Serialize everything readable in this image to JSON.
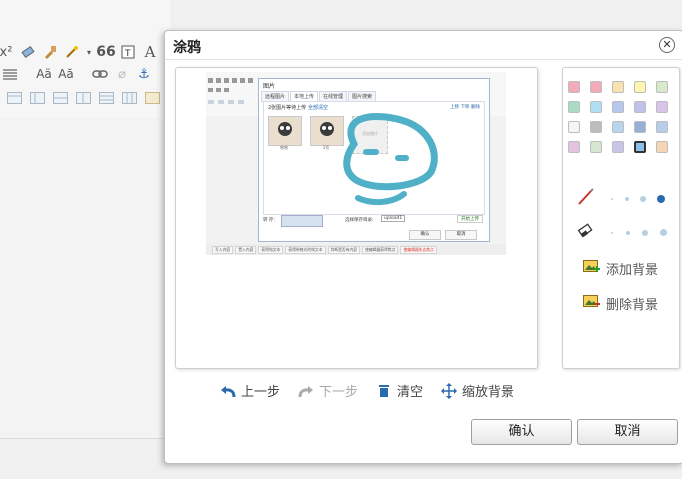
{
  "background": {
    "toolbar_rows": [
      {
        "icons": [
          "superscript-icon",
          "eraser-icon",
          "format-brush-icon",
          "magic-wand-icon",
          "chevron-down-icon",
          "quote-icon",
          "text-box-icon",
          "font-icon"
        ]
      },
      {
        "icons": [
          "align-justify-icon",
          "font-size-up-icon",
          "font-size-down-icon",
          "link-icon",
          "unlink-icon",
          "anchor-icon"
        ]
      },
      {
        "icons": [
          "table-icon",
          "table-row-icon",
          "table-col-icon",
          "table-merge-icon",
          "table-split-icon",
          "table-delete-icon",
          "image-icon"
        ]
      }
    ]
  },
  "dialog": {
    "title": "涂鸦",
    "close_glyph": "✕"
  },
  "canvas_screenshot": {
    "dialog_title": "图片",
    "tabs": [
      "远程图片",
      "本地上传",
      "在线管理",
      "图片搜索"
    ],
    "upload_head": "2张图片等待上传",
    "clear_link": "全部清空",
    "actions": [
      "上移",
      "下移",
      "删除"
    ],
    "thumbs": [
      {
        "label": "哈哈"
      },
      {
        "label": "1号"
      }
    ],
    "placeholder": "添加图片",
    "bar_label_left": "转 存:",
    "bar_label_mid": "选择保存目录:",
    "bar_select": "upload1",
    "start_upload": "开始上传",
    "confirm": "确认",
    "cancel": "取消",
    "status_items": [
      "写入内容",
      "置入内容",
      "获得纯文本",
      "获得带格式的纯文本",
      "判断是否有内容",
      "使编辑器获得焦点",
      "使编辑器失去焦点"
    ]
  },
  "controls": {
    "undo": "上一步",
    "redo": "下一步",
    "clear": "清空",
    "scale_bg": "缩放背景"
  },
  "colors": {
    "swatches": [
      "#f3aab9",
      "#f3aab9",
      "#f8e2b0",
      "#fbf5b0",
      "#d7ebcc",
      "#a9dcc6",
      "#b0dff3",
      "#b6c8ec",
      "#c0c2ea",
      "#d9c3e8",
      "#f6f6f6",
      "#bdbdbd",
      "#b7d6ee",
      "#98afd6",
      "#b8cde9",
      "#e3c3df",
      "#d6e6cf",
      "#c7c6e8",
      "#8fc0ea",
      "#f6d5b7"
    ],
    "selected_index": 18,
    "brush_dot_color": "#2a6bb0",
    "dot_color": "#b5cfe3",
    "scribble": "#4fb0c8"
  },
  "side_actions": {
    "add_background": "添加背景",
    "remove_background": "删除背景"
  },
  "buttons": {
    "confirm": "确认",
    "cancel": "取消"
  }
}
